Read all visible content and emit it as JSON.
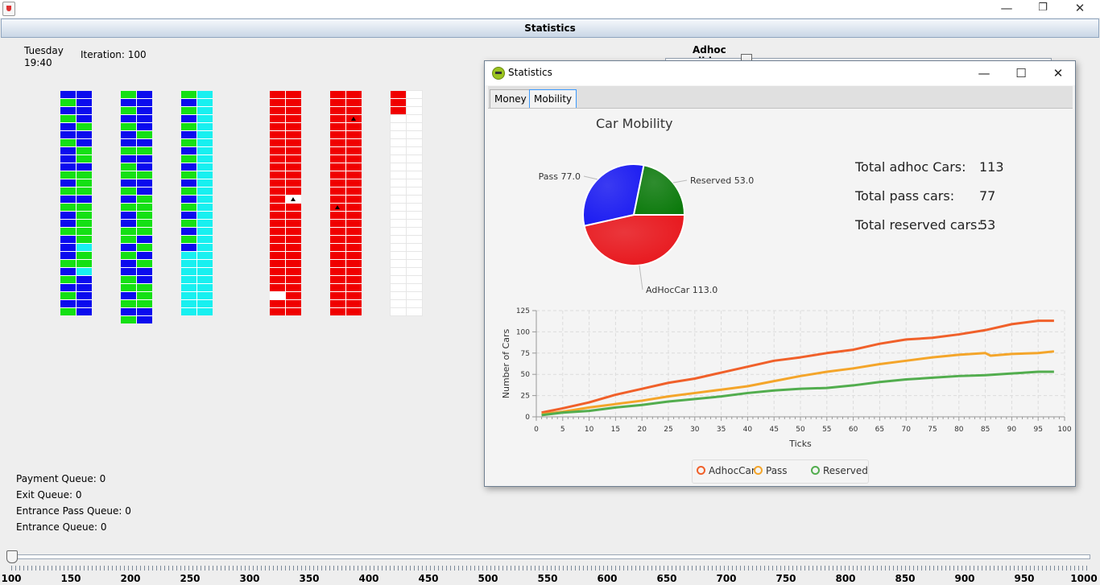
{
  "window": {
    "controls": [
      "—",
      "❐",
      "✕"
    ]
  },
  "tab_title": "Statistics",
  "status": {
    "day": "Tuesday",
    "time": "19:40",
    "iteration": "Iteration: 100"
  },
  "adhoc_slider": {
    "label": "Adhoc slider"
  },
  "parking_floors": [
    {
      "rows": [
        "BB",
        "GB",
        "BB",
        "GB",
        "BG",
        "BB",
        "GB",
        "BG",
        "BG",
        "BB",
        "GG",
        "BG",
        "GG",
        "BB",
        "GG",
        "BG",
        "BG",
        "GG",
        "BG",
        "BC",
        "BG",
        "GG",
        "BC",
        "GB",
        "BB",
        "GB",
        "BB",
        "GB"
      ]
    },
    {
      "rows": [
        "GB",
        "BB",
        "GB",
        "BB",
        "GB",
        "BG",
        "BB",
        "GG",
        "BB",
        "GB",
        "GG",
        "BB",
        "GB",
        "BG",
        "GG",
        "BG",
        "BG",
        "GG",
        "GB",
        "BG",
        "GB",
        "BG",
        "BB",
        "GB",
        "GG",
        "BG",
        "GG",
        "BB",
        "GB"
      ]
    },
    {
      "rows": [
        "GC",
        "BC",
        "GC",
        "BC",
        "GC",
        "BC",
        "GC",
        "BC",
        "GC",
        "BC",
        "GC",
        "BC",
        "GC",
        "BC",
        "GC",
        "BC",
        "GC",
        "BC",
        "GC",
        "BC",
        "CC",
        "CC",
        "CC",
        "CC",
        "CC",
        "CC",
        "CC",
        "CC"
      ]
    },
    {
      "rows": [
        "RR",
        "RR",
        "RR",
        "RR",
        "RR",
        "RR",
        "RR",
        "RR",
        "RR",
        "RR",
        "RR",
        "RR",
        "RR",
        "RW",
        "RR",
        "RR",
        "RR",
        "RR",
        "RR",
        "RR",
        "RR",
        "RR",
        "RR",
        "RR",
        "RR",
        "WR",
        "RR",
        "RR"
      ]
    },
    {
      "rows": [
        "RR",
        "RR",
        "RR",
        "RR",
        "RR",
        "RR",
        "RR",
        "RR",
        "RR",
        "RR",
        "RR",
        "RR",
        "RR",
        "RR",
        "RR",
        "RR",
        "RR",
        "RR",
        "RR",
        "RR",
        "RR",
        "RR",
        "RR",
        "RR",
        "RR",
        "RR",
        "RR",
        "RR"
      ]
    },
    {
      "rows": [
        "RW",
        "RW",
        "RW",
        "WW",
        "WW",
        "WW",
        "WW",
        "WW",
        "WW",
        "WW",
        "WW",
        "WW",
        "WW",
        "WW",
        "WW",
        "WW",
        "WW",
        "WW",
        "WW",
        "WW",
        "WW",
        "WW",
        "WW",
        "WW",
        "WW",
        "WW",
        "WW",
        "WW"
      ]
    }
  ],
  "queues": {
    "payment": "Payment Queue: 0",
    "exit": "Exit Queue: 0",
    "entrance_pass": "Entrance Pass Queue: 0",
    "entrance": "Entrance Queue: 0"
  },
  "speed_slider": {
    "value": 100,
    "min": 100,
    "max": 1000,
    "labels": [
      "100",
      "150",
      "200",
      "250",
      "300",
      "350",
      "400",
      "450",
      "500",
      "550",
      "600",
      "650",
      "700",
      "750",
      "800",
      "850",
      "900",
      "950",
      "1000"
    ]
  },
  "stats_window": {
    "title": "Statistics",
    "tabs": [
      {
        "label": "Money"
      },
      {
        "label": "Mobility"
      }
    ],
    "active_tab": "Mobility",
    "heading": "Car Mobility",
    "totals": [
      {
        "label": "Total adhoc Cars:",
        "value": "113"
      },
      {
        "label": "Total pass cars:",
        "value": "77"
      },
      {
        "label": "Total reserved cars:",
        "value": "53"
      }
    ]
  },
  "chart_data": [
    {
      "type": "pie",
      "title": "Car Mobility",
      "slices": [
        {
          "label": "AdHocCar 113.0",
          "value": 113.0,
          "color": "#e8151b"
        },
        {
          "label": "Pass 77.0",
          "value": 77.0,
          "color": "#1a1af2"
        },
        {
          "label": "Reserved 53.0",
          "value": 53.0,
          "color": "#0c7a0c"
        }
      ]
    },
    {
      "type": "line",
      "xlabel": "Ticks",
      "ylabel": "Number of Cars",
      "xlim": [
        0,
        100
      ],
      "ylim": [
        0,
        125
      ],
      "xticks": [
        0,
        5,
        10,
        15,
        20,
        25,
        30,
        35,
        40,
        45,
        50,
        55,
        60,
        65,
        70,
        75,
        80,
        85,
        90,
        95,
        100
      ],
      "yticks": [
        0,
        25,
        50,
        75,
        100,
        125
      ],
      "grid": true,
      "legend": "bottom",
      "series": [
        {
          "name": "AdhocCar",
          "color": "#f0602a",
          "x": [
            1,
            5,
            10,
            15,
            20,
            25,
            30,
            35,
            40,
            45,
            50,
            55,
            60,
            65,
            70,
            75,
            80,
            85,
            90,
            95,
            98
          ],
          "y": [
            5,
            10,
            17,
            26,
            33,
            40,
            45,
            52,
            59,
            66,
            70,
            75,
            79,
            86,
            91,
            93,
            97,
            102,
            109,
            113,
            113
          ]
        },
        {
          "name": "Pass",
          "color": "#f4a52a",
          "x": [
            1,
            5,
            10,
            15,
            20,
            25,
            30,
            35,
            40,
            45,
            50,
            55,
            60,
            65,
            70,
            75,
            80,
            85,
            86,
            90,
            95,
            98
          ],
          "y": [
            3,
            6,
            11,
            15,
            19,
            24,
            28,
            32,
            36,
            42,
            48,
            53,
            57,
            62,
            66,
            70,
            73,
            75,
            72,
            74,
            75,
            77
          ]
        },
        {
          "name": "Reserved",
          "color": "#52ad4e",
          "x": [
            1,
            5,
            10,
            15,
            20,
            25,
            30,
            35,
            40,
            45,
            50,
            55,
            60,
            65,
            70,
            75,
            80,
            85,
            90,
            95,
            98
          ],
          "y": [
            2,
            5,
            7,
            11,
            14,
            18,
            21,
            24,
            28,
            31,
            33,
            34,
            37,
            41,
            44,
            46,
            48,
            49,
            51,
            53,
            53
          ]
        }
      ]
    }
  ],
  "colors": {
    "blue": "#0b0bee",
    "green": "#14e014",
    "cyan": "#18f0f0",
    "red": "#f00000",
    "white": "#ffffff"
  }
}
